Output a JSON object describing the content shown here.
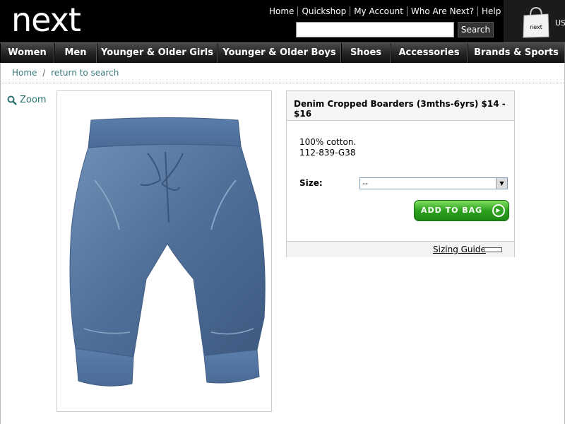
{
  "header": {
    "logo": "next",
    "links": [
      "Home",
      "Quickshop",
      "My Account",
      "Who Are Next?",
      "Help"
    ],
    "search": {
      "value": "",
      "placeholder": "",
      "button_label": "Search"
    },
    "bag_label": "next",
    "locale": "US"
  },
  "nav": {
    "items": [
      "Women",
      "Men",
      "Younger & Older Girls",
      "Younger & Older Boys",
      "Shoes",
      "Accessories",
      "Brands & Sports"
    ]
  },
  "breadcrumb": {
    "home": "Home",
    "separator": "/",
    "back": "return to search"
  },
  "zoom": {
    "label": "Zoom"
  },
  "product": {
    "title": "Denim Cropped Boarders (3mths-6yrs) $14 - $16",
    "material": "100% cotton.",
    "code": "112-839-G38",
    "size_label": "Size:",
    "size_selected": "--",
    "add_to_bag": "ADD TO BAG",
    "sizing_guide": "Sizing Guide"
  },
  "colors": {
    "header_bg": "#000000",
    "link_teal": "#3a7a7a",
    "add_bag_green": "#2ea21e"
  }
}
